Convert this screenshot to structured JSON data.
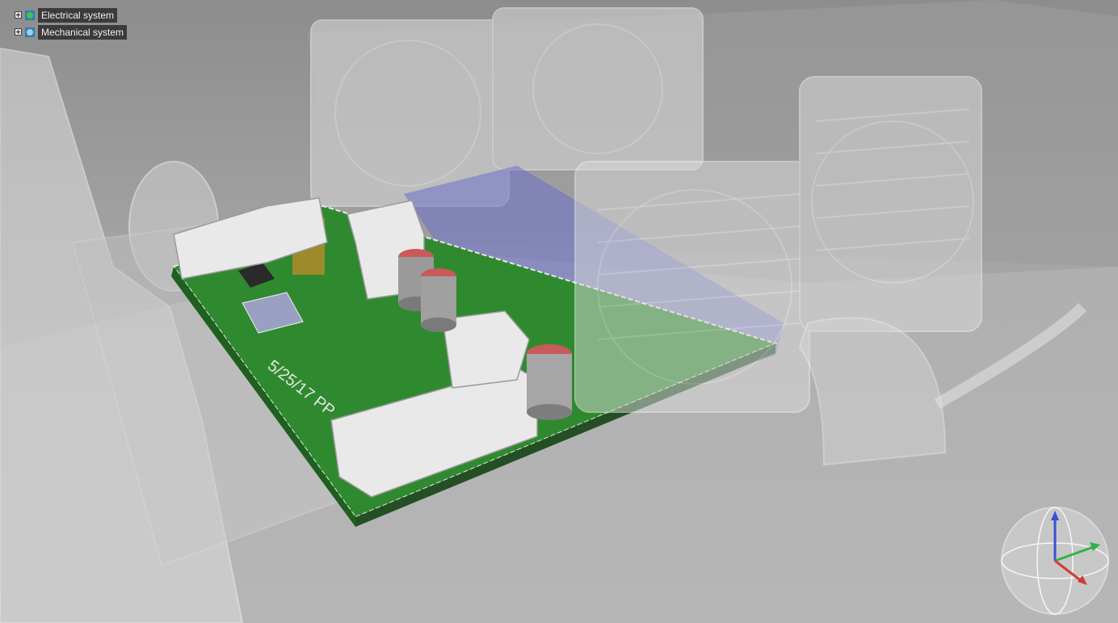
{
  "tree": {
    "items": [
      {
        "label": "Electrical system",
        "icon": "electrical-system-icon"
      },
      {
        "label": "Mechanical system",
        "icon": "mechanical-system-icon"
      }
    ]
  },
  "board": {
    "silkscreen": "5/25/17 PP"
  },
  "colors": {
    "pcb": "#2f8a2f",
    "ghost_plastic": "#d4d4d4",
    "blue_board": "#6a70c8",
    "axis_x": "#d23a3a",
    "axis_y": "#2fb34a",
    "axis_z": "#3b4fd6"
  }
}
